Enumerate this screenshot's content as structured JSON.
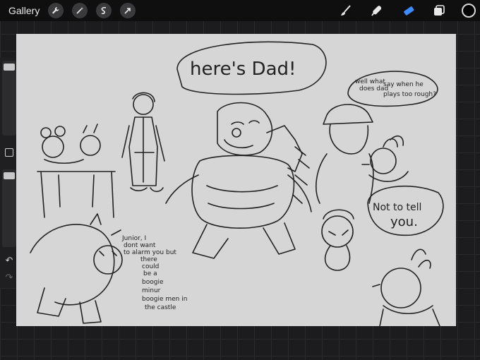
{
  "topbar": {
    "gallery_label": "Gallery",
    "left_tools": [
      "wrench-icon",
      "magic-wand-icon",
      "selection-icon",
      "transform-arrow-icon"
    ],
    "right_tools": [
      "brush-icon",
      "smudge-icon",
      "eraser-icon",
      "layers-icon"
    ],
    "active_tool": "eraser-icon",
    "current_color": "#000000"
  },
  "sidebar": {
    "brush_size_level": 0.05,
    "opacity_level": 0.05,
    "undo_glyph": "↶",
    "redo_glyph": "↷"
  },
  "canvas": {
    "bubble_dad": "here's Dad!",
    "bubble_question_line1": "well what",
    "bubble_question_line2": "does dad",
    "bubble_question_line3": "say when he",
    "bubble_question_line4": "plays too rough?",
    "bubble_nottotell_line1": "Not to tell",
    "bubble_nottotell_line2": "you.",
    "note_line1": "Junior, I",
    "note_line2": "dont want",
    "note_line3": "to alarm you but",
    "note_line4": "there",
    "note_line5": "could",
    "note_line6": "be a",
    "note_line7": "boogie",
    "note_line8": "minur",
    "note_line9": "boogie men in",
    "note_line10": "the castle"
  },
  "colors": {
    "accent_blue": "#3d8bff",
    "toolbar_bg": "#0f0f10",
    "canvas_bg": "#d6d6d6"
  }
}
